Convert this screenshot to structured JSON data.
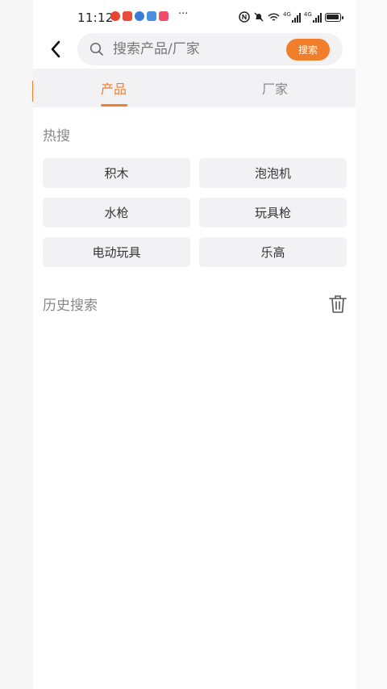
{
  "status_bar": {
    "time": "11:12",
    "more": "···",
    "net_1": "4G",
    "net_2": "4G"
  },
  "search": {
    "placeholder": "搜索产品/厂家",
    "value": "",
    "button_label": "搜索"
  },
  "tabs": [
    {
      "label": "产品",
      "active": true
    },
    {
      "label": "厂家",
      "active": false
    }
  ],
  "hot_search": {
    "title": "热搜",
    "items": [
      "积木",
      "泡泡机",
      "水枪",
      "玩具枪",
      "电动玩具",
      "乐高"
    ]
  },
  "history": {
    "title": "历史搜索",
    "items": []
  },
  "colors": {
    "accent": "#f07e2b",
    "chip_bg": "#f2f2f4",
    "muted_text": "#888888"
  },
  "icons": [
    "back-arrow-icon",
    "search-icon",
    "trash-icon"
  ]
}
